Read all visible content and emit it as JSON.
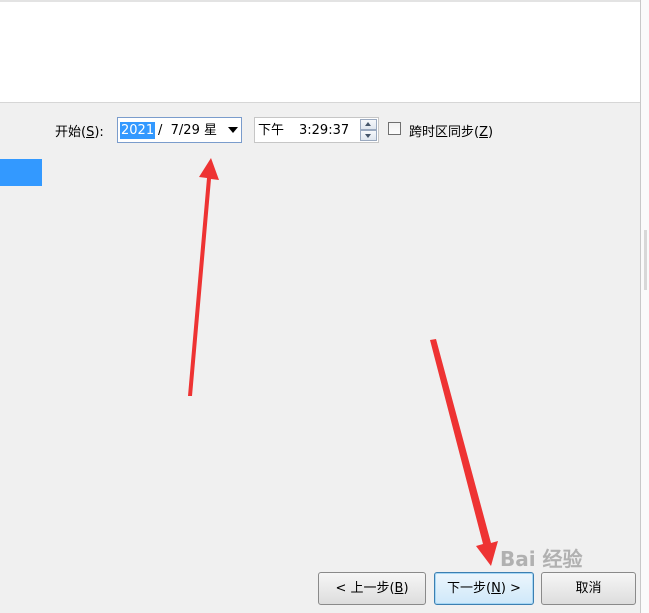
{
  "start": {
    "label_pre": "开始(",
    "label_key": "S",
    "label_post": "):"
  },
  "date": {
    "year": "2021",
    "rest": "/  7/29 星"
  },
  "time": {
    "ampm": "下午",
    "value": "3:29:37"
  },
  "sync": {
    "label_pre": "跨时区同步(",
    "label_key": "Z",
    "label_post": ")",
    "checked": false
  },
  "buttons": {
    "back": {
      "pre": "< 上一步(",
      "key": "B",
      "post": ")"
    },
    "next": {
      "pre": "下一步(",
      "key": "N",
      "post": ") >"
    },
    "cancel": "取消"
  },
  "watermark": "Bai 经验",
  "colors": {
    "selection": "#3399ff",
    "arrow": "#ee3333"
  }
}
